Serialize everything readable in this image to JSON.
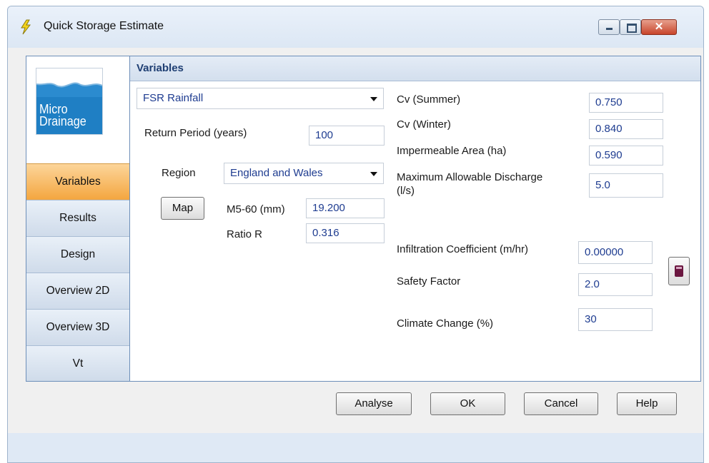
{
  "window": {
    "title": "Quick Storage Estimate",
    "icon": "pencil-lightning-icon",
    "controls": {
      "minimize": "minimize-icon",
      "maximize": "maximize-icon",
      "close": "close-icon",
      "close_glyph": "✕"
    }
  },
  "logo": {
    "line1": "Micro",
    "line2": "Drainage"
  },
  "nav": {
    "items": [
      {
        "label": "Variables",
        "active": true
      },
      {
        "label": "Results",
        "active": false
      },
      {
        "label": "Design",
        "active": false
      },
      {
        "label": "Overview 2D",
        "active": false
      },
      {
        "label": "Overview 3D",
        "active": false
      },
      {
        "label": "Vt",
        "active": false
      }
    ]
  },
  "section": {
    "title": "Variables"
  },
  "left": {
    "rainfall_method": "FSR Rainfall",
    "return_period_label": "Return Period (years)",
    "return_period_value": "100",
    "region_label": "Region",
    "region_value": "England and Wales",
    "map_button": "Map",
    "m560_label": "M5-60 (mm)",
    "m560_value": "19.200",
    "ratio_label": "Ratio R",
    "ratio_value": "0.316"
  },
  "right": {
    "cv_summer_label": "Cv (Summer)",
    "cv_summer_value": "0.750",
    "cv_winter_label": "Cv (Winter)",
    "cv_winter_value": "0.840",
    "imp_area_label": "Impermeable Area (ha)",
    "imp_area_value": "0.590",
    "max_discharge_label_1": "Maximum Allowable Discharge",
    "max_discharge_label_2": "(l/s)",
    "max_discharge_value": "5.0",
    "infiltration_label": "Infiltration Coefficient (m/hr)",
    "infiltration_value": "0.00000",
    "calculator_icon": "calculator-icon",
    "safety_label": "Safety Factor",
    "safety_value": "2.0",
    "climate_label": "Climate Change (%)",
    "climate_value": "30"
  },
  "buttons": {
    "analyse": "Analyse",
    "ok": "OK",
    "cancel": "Cancel",
    "help": "Help"
  },
  "colors": {
    "accent_active": "#f4a63f",
    "value_text": "#1e3c90",
    "header_text": "#1f3f73"
  }
}
